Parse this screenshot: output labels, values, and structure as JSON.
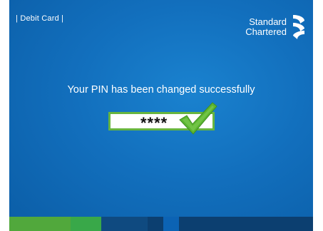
{
  "header": {
    "section_label": "| Debit Card |",
    "brand_line1": "Standard",
    "brand_line2": "Chartered"
  },
  "main": {
    "message": "Your PIN has been changed successfully",
    "pin_masked": "****",
    "status_icon": "checkmark-icon"
  },
  "colors": {
    "background": "#126fbd",
    "pin_border": "#67b53f",
    "checkmark": "#5cb530",
    "bottom_bar": [
      "#51a83c",
      "#39a849",
      "#0f4a80",
      "#0c3f70",
      "#0c63b4",
      "#0c3f70"
    ]
  }
}
